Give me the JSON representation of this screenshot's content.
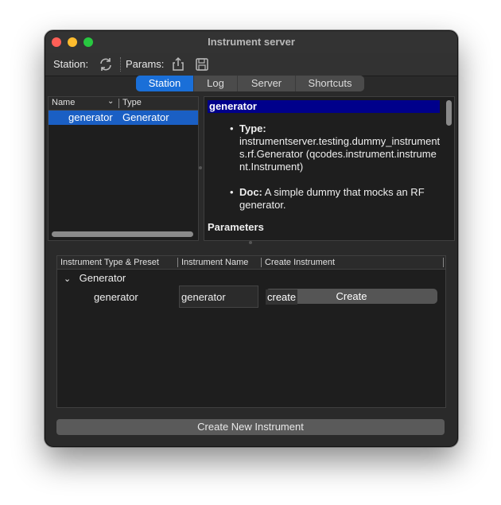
{
  "window": {
    "title": "Instrument server"
  },
  "toolbar": {
    "station_label": "Station:",
    "refresh_icon": "refresh-icon",
    "params_label": "Params:",
    "share_icon": "share-icon",
    "save_icon": "save-icon"
  },
  "tabs": [
    "Station",
    "Log",
    "Server",
    "Shortcuts"
  ],
  "active_tab": "Station",
  "station_list": {
    "columns": [
      "Name",
      "Type"
    ],
    "rows": [
      {
        "name": "generator",
        "type": "Generator"
      }
    ]
  },
  "doc": {
    "heading": "generator",
    "type_label": "Type:",
    "type_value": "instrumentserver.testing.dummy_instruments.rf.Generator (qcodes.instrument.instrument.Instrument)",
    "doc_label": "Doc:",
    "doc_value": "A simple dummy that mocks an RF generator.",
    "params_heading": "Parameters"
  },
  "create_table": {
    "columns": [
      "Instrument Type & Preset",
      "Instrument Name",
      "Create Instrument"
    ],
    "group": "Generator",
    "item": "generator",
    "name_value": "generator",
    "create_text": "create",
    "create_button": "Create"
  },
  "create_new_button": "Create New Instrument",
  "colors": {
    "accent": "#1a6fd8",
    "selection": "#1a5fc4",
    "doc_heading_bg": "#00008b"
  }
}
